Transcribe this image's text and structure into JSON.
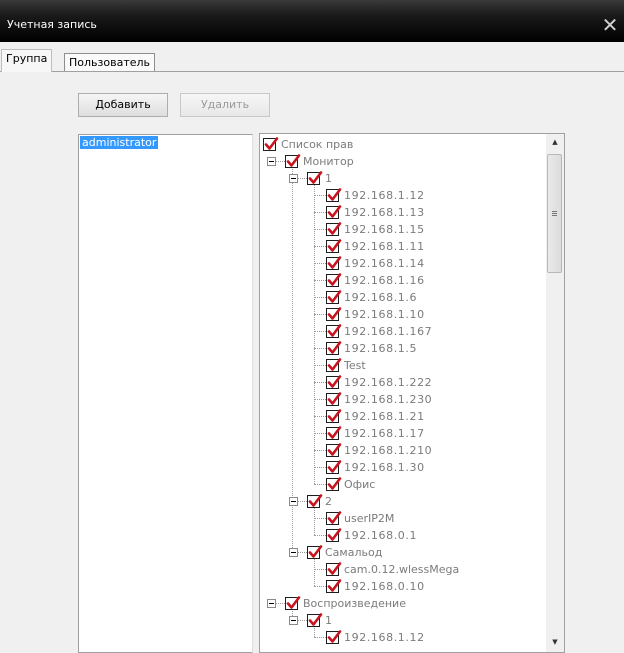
{
  "window": {
    "title": "Учетная запись",
    "close_glyph": "✕"
  },
  "tabs": [
    {
      "label": "Группа",
      "active": true
    },
    {
      "label": "Пользователь",
      "active": false
    }
  ],
  "toolbar": {
    "add_label": "Добавить",
    "delete_label": "Удалить",
    "delete_enabled": false
  },
  "users": {
    "selected": "administrator"
  },
  "permissions": {
    "root": "Список прав",
    "monitor": {
      "label": "Монитор",
      "group1": {
        "label": "1",
        "items": [
          "192.168.1.12",
          "192.168.1.13",
          "192.168.1.15",
          "192.168.1.11",
          "192.168.1.14",
          "192.168.1.16",
          "192.168.1.6",
          "192.168.1.10",
          "192.168.1.167",
          "192.168.1.5",
          "Test",
          "192.168.1.222",
          "192.168.1.230",
          "192.168.1.21",
          "192.168.1.17",
          "192.168.1.210",
          "192.168.1.30",
          "Офис"
        ]
      },
      "group2": {
        "label": "2",
        "items": [
          "userIP2M",
          "192.168.0.1"
        ]
      },
      "group3": {
        "label": "Самальод",
        "items": [
          "cam.0.12.wlessMega",
          "192.168.0.10"
        ]
      }
    },
    "playback": {
      "label": "Воспроизведение",
      "group1": {
        "label": "1",
        "items": [
          "192.168.1.12"
        ]
      }
    }
  },
  "colors": {
    "check": "#c8141e",
    "selection": "#3399ff",
    "titlebar": "#000000"
  },
  "icons": {
    "close": "close-icon",
    "check": "checkmark-icon",
    "collapse": "minus-box-icon"
  }
}
